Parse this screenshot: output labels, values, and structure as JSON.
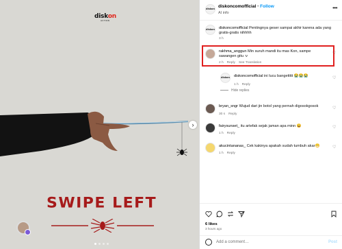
{
  "media": {
    "logo_text": "disk",
    "logo_text_accent": "on",
    "logo_sub": "ACTION",
    "headline": "SWIPE LEFT",
    "next_icon": "›",
    "accent_color": "#a61a1a"
  },
  "post_header": {
    "avatar_text": "diskon",
    "username": "diskoncomofficial",
    "dot": "•",
    "follow_label": "Follow",
    "subtitle": "AI info",
    "more_icon": "•••"
  },
  "comments": [
    {
      "avatar": "diskon",
      "username": "diskoncomofficial",
      "text": "Pentingnya geser sampai akhir karena ada yang gratis-gratis nihhhh",
      "time": "3 h",
      "reply": "",
      "translate": ""
    },
    {
      "avatar": "",
      "username": "rakhma_anggun",
      "text": "Min suruh mandi itu mas Kon, sampe sawangen gitu :v",
      "time": "2 h",
      "reply": "Reply",
      "translate": "See Translation"
    },
    {
      "avatar": "diskon",
      "username": "diskoncomofficial",
      "text": "ini lucu bangettttt 😭😭😭",
      "time": "1 h",
      "reply": "Reply",
      "translate": ""
    },
    {
      "avatar": "",
      "username": "bryan_sngr",
      "text": "Wujud dari jin botol yang pernah digosokgosok",
      "time": "30 s",
      "reply": "Reply",
      "translate": ""
    },
    {
      "avatar": "",
      "username": "fairysunset_",
      "text": "itu artefak sejak jaman apa minn 😀",
      "time": "1 h",
      "reply": "Reply",
      "translate": ""
    },
    {
      "avatar": "",
      "username": "akucintananas_",
      "text": "Cek kakinya apakah sudah tumbuh akar😁",
      "time": "1 h",
      "reply": "Reply",
      "translate": ""
    }
  ],
  "hide_replies": "Hide replies",
  "likes": "6 likes",
  "posted": "3 hours ago",
  "add_comment_placeholder": "Add a comment…",
  "post_label": "Post"
}
